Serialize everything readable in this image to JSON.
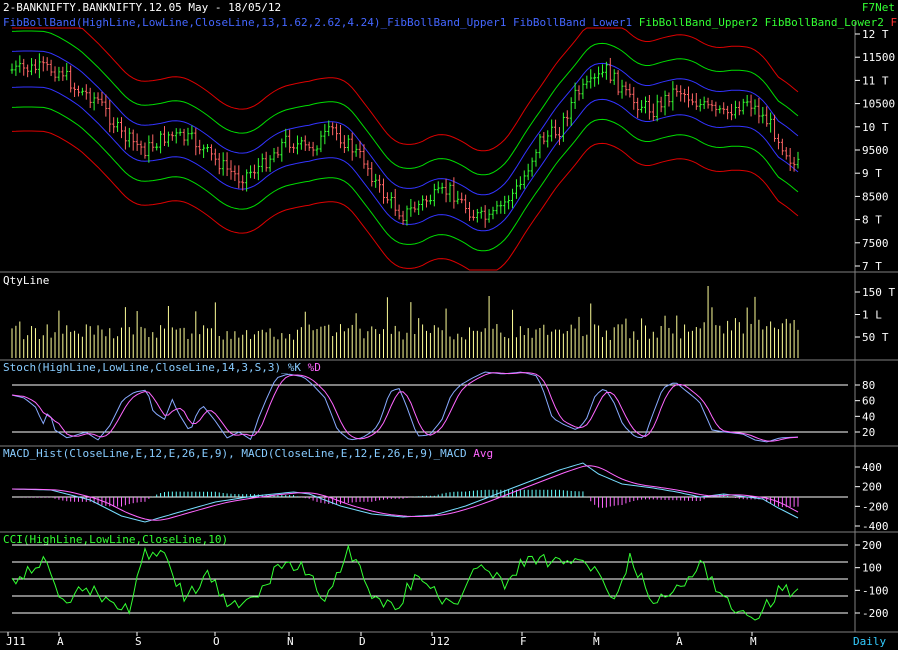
{
  "app": {
    "title": "2-BANKNIFTY.BANKNIFTY.12.05 May - 18/05/12",
    "brand": "F7Net",
    "periodicity": "Daily"
  },
  "colors": {
    "background": "#000000",
    "divider": "#808080",
    "axis_text": "#ffffff",
    "bull_bar": "#33ff33",
    "bear_bar": "#ff6666",
    "band_blue": "#3333ff",
    "band_green": "#00dd00",
    "band_red": "#dd0000",
    "qty_bar": "#ffff99",
    "stoch_k": "#88aaff",
    "stoch_d": "#ff66ff",
    "macd_line": "#77ddff",
    "macd_avg": "#ff66ff",
    "macd_hist_pos": "#66ffff",
    "macd_hist_neg": "#ff66ff",
    "cci": "#33ff33",
    "level_line": "#ffffff"
  },
  "panes": {
    "price": {
      "legend": [
        {
          "text": "FibBollBand(HighLine,LowLine,CloseLine,13,1.62,2.62,4.24)_FibBollBand_Upper1",
          "color": "#4466ff"
        },
        {
          "text": "FibBollBand_Lower1",
          "color": "#4466ff"
        },
        {
          "text": "FibBollBand_Upper2",
          "color": "#33ff33"
        },
        {
          "text": "FibBollBand_Lower2",
          "color": "#33ff33"
        },
        {
          "text": "FibBollBand_",
          "color": "#ff3333"
        }
      ],
      "axis_labels": [
        "12 T",
        "11500",
        "11 T",
        "10500",
        "10 T",
        "9500",
        "9 T",
        "8500",
        "8 T",
        "7500",
        "7 T"
      ]
    },
    "qty": {
      "legend": [
        {
          "text": "QtyLine",
          "color": "#ffffff"
        }
      ],
      "axis_labels": [
        "150 T",
        "1 L",
        "50 T"
      ]
    },
    "stoch": {
      "legend": [
        {
          "text": "Stoch(HighLine,LowLine,CloseLine,14,3,S,3)_%K",
          "color": "#88ccff"
        },
        {
          "text": "%D",
          "color": "#ff66ff"
        }
      ],
      "axis_labels": [
        "80",
        "60",
        "40",
        "20"
      ]
    },
    "macd": {
      "legend": [
        {
          "text": "MACD_Hist(CloseLine,E,12,E,26,E,9),",
          "color": "#88ccff"
        },
        {
          "text": "MACD(CloseLine,E,12,E,26,E,9)_MACD",
          "color": "#88ccff"
        },
        {
          "text": "Avg",
          "color": "#ff66ff"
        }
      ],
      "axis_labels": [
        "400",
        "200",
        "-200",
        "-400"
      ]
    },
    "cci": {
      "legend": [
        {
          "text": "CCI(HighLine,LowLine,CloseLine,10)",
          "color": "#33ff33"
        }
      ],
      "axis_labels": [
        "200",
        "100",
        "-100",
        "-200"
      ]
    }
  },
  "time_axis": [
    "J11",
    "A",
    "S",
    "O",
    "N",
    "D",
    "J12",
    "F",
    "M",
    "A",
    "M"
  ]
}
